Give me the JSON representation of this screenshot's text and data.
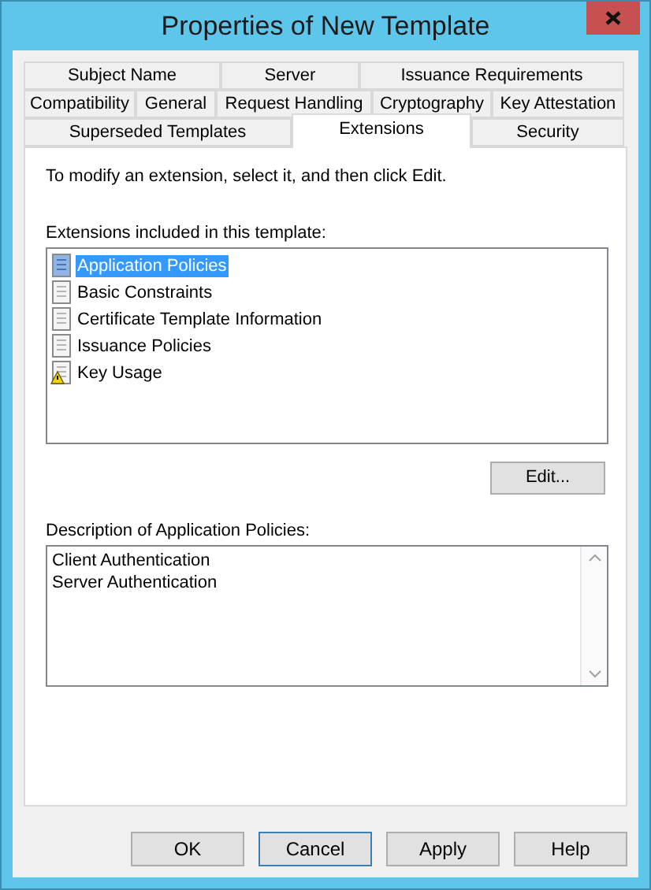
{
  "window": {
    "title": "Properties of New Template"
  },
  "tab_rows": [
    [
      {
        "label": "Subject Name",
        "selected": false
      },
      {
        "label": "Server",
        "selected": false
      },
      {
        "label": "Issuance Requirements",
        "selected": false
      }
    ],
    [
      {
        "label": "Compatibility",
        "selected": false
      },
      {
        "label": "General",
        "selected": false
      },
      {
        "label": "Request Handling",
        "selected": false
      },
      {
        "label": "Cryptography",
        "selected": false
      },
      {
        "label": "Key Attestation",
        "selected": false
      }
    ],
    [
      {
        "label": "Superseded Templates",
        "selected": false
      },
      {
        "label": "Extensions",
        "selected": true
      },
      {
        "label": "Security",
        "selected": false
      }
    ]
  ],
  "instruction": "To modify an extension, select it, and then click Edit.",
  "extensions_label": "Extensions included in this template:",
  "extensions": [
    {
      "label": "Application Policies",
      "selected": true,
      "kind": "normal"
    },
    {
      "label": "Basic Constraints",
      "selected": false,
      "kind": "normal"
    },
    {
      "label": "Certificate Template Information",
      "selected": false,
      "kind": "normal"
    },
    {
      "label": "Issuance Policies",
      "selected": false,
      "kind": "normal"
    },
    {
      "label": "Key Usage",
      "selected": false,
      "kind": "warning"
    }
  ],
  "edit_button": "Edit...",
  "description_label": "Description of Application Policies:",
  "description_lines": [
    "Client Authentication",
    "Server Authentication"
  ],
  "buttons": [
    {
      "label": "OK",
      "selected": false
    },
    {
      "label": "Cancel",
      "selected": true
    },
    {
      "label": "Apply",
      "selected": false
    },
    {
      "label": "Help",
      "selected": false
    }
  ]
}
